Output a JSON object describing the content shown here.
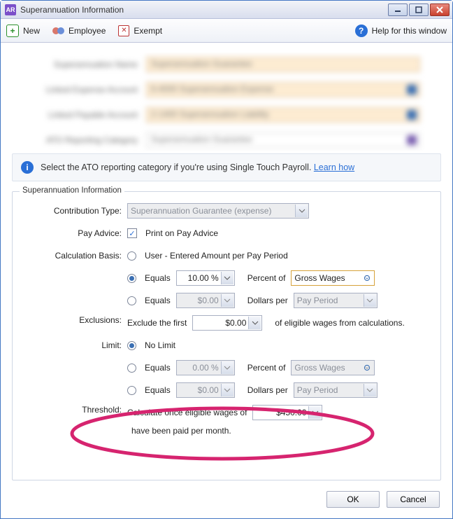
{
  "window": {
    "title": "Superannuation Information",
    "icon_text": "AR"
  },
  "toolbar": {
    "new_label": "New",
    "employee_label": "Employee",
    "exempt_label": "Exempt",
    "help_label": "Help for this window"
  },
  "blur": {
    "rows": [
      {
        "label": "Superannuation Name",
        "value": "Superannuation Guarantee"
      },
      {
        "label": "Linked Expense Account",
        "value": "6-4000 Superannuation Expense"
      },
      {
        "label": "Linked Payable Account",
        "value": "2-1400 Superannuation Liability"
      },
      {
        "label": "ATO Reporting Category",
        "value": "Superannuation Guarantee"
      }
    ]
  },
  "banner": {
    "text": "Select the ATO reporting category if you're using Single Touch Payroll.",
    "link": "Learn how"
  },
  "group": {
    "legend": "Superannuation Information",
    "contribution_type_label": "Contribution Type:",
    "contribution_type_value": "Superannuation Guarantee (expense)",
    "pay_advice_label": "Pay Advice:",
    "pay_advice_check": "Print on Pay Advice",
    "calc_basis_label": "Calculation Basis:",
    "calc_user": "User - Entered Amount per Pay Period",
    "calc_equals": "Equals",
    "calc_percent_value": "10.00 %",
    "calc_percent_of": "Percent of",
    "calc_percent_field": "Gross Wages",
    "calc_dollar_value": "$0.00",
    "calc_dollars_per": "Dollars per",
    "calc_dollars_field": "Pay Period",
    "exclusions_label": "Exclusions:",
    "exclusions_pre": "Exclude the first",
    "exclusions_value": "$0.00",
    "exclusions_post": "of eligible wages from calculations.",
    "limit_label": "Limit:",
    "limit_none": "No Limit",
    "limit_percent_value": "0.00 %",
    "limit_percent_field": "Gross Wages",
    "limit_dollar_value": "$0.00",
    "limit_dollar_field": "Pay Period",
    "threshold_label": "Threshold:",
    "threshold_pre": "Calculate once eligible wages of",
    "threshold_value": "$450.00",
    "threshold_post": "have been paid per month."
  },
  "footer": {
    "ok": "OK",
    "cancel": "Cancel"
  }
}
